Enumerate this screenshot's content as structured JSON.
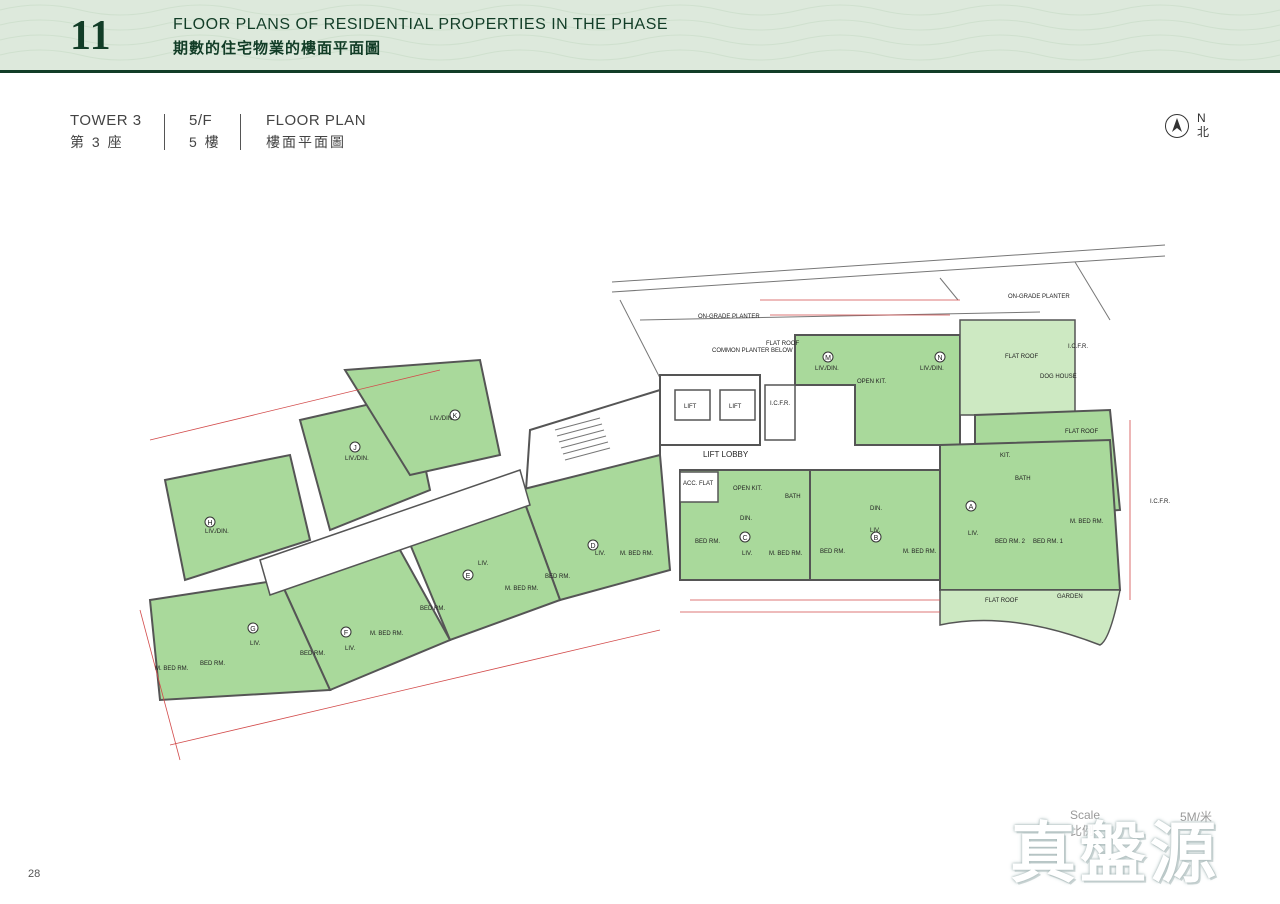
{
  "header": {
    "chapter_number": "11",
    "title_en": "FLOOR PLANS OF RESIDENTIAL PROPERTIES IN THE PHASE",
    "title_zh": "期數的住宅物業的樓面平面圖"
  },
  "subheader": {
    "tower_en": "TOWER 3",
    "tower_zh": "第 3 座",
    "floor_en": "5/F",
    "floor_zh": "5 樓",
    "plan_en": "FLOOR PLAN",
    "plan_zh": "樓面平面圖"
  },
  "north": {
    "en": "N",
    "zh": "北"
  },
  "plan_labels": {
    "on_grade_planter_1": "ON-GRADE PLANTER",
    "on_grade_planter_2": "ON-GRADE PLANTER",
    "common_planter": "COMMON PLANTER BELOW",
    "lift_1": "LIFT",
    "lift_2": "LIFT",
    "lift_lobby": "LIFT LOBBY",
    "icfr_1": "I.C.F.R.",
    "icfr_2": "I.C.F.R.",
    "icfr_3": "I.C.F.R.",
    "flat_roof_1": "FLAT ROOF",
    "flat_roof_2": "FLAT ROOF",
    "flat_roof_3": "FLAT ROOF",
    "flat_roof_4": "FLAT ROOF",
    "garden": "GARDEN",
    "acc_flat": "ACC. FLAT",
    "dog_house": "DOG HOUSE",
    "liv_din": "LIV./DIN.",
    "liv": "LIV.",
    "din": "DIN.",
    "open_kit": "OPEN KIT.",
    "bed_rm": "BED RM.",
    "m_bed_rm": "M. BED RM.",
    "bed_rm_1": "BED RM. 1",
    "bed_rm_2": "BED RM. 2",
    "bath": "BATH",
    "kit": "KIT.",
    "flat_a": "A",
    "flat_b": "B",
    "flat_c": "C",
    "flat_d": "D",
    "flat_e": "E",
    "flat_f": "F",
    "flat_g": "G",
    "flat_h": "H",
    "flat_j": "J",
    "flat_k": "K",
    "flat_m": "M",
    "flat_n": "N"
  },
  "scale": {
    "label_en": "Scale",
    "label_zh": "比例",
    "unit": "5M/米"
  },
  "watermark": "真盤源",
  "page_number": "28",
  "colors": {
    "header_bg": "#dde9dc",
    "header_dark": "#123d27",
    "flat_fill": "#a9d99b",
    "wall": "#555555",
    "dimension": "#d24a4a"
  }
}
